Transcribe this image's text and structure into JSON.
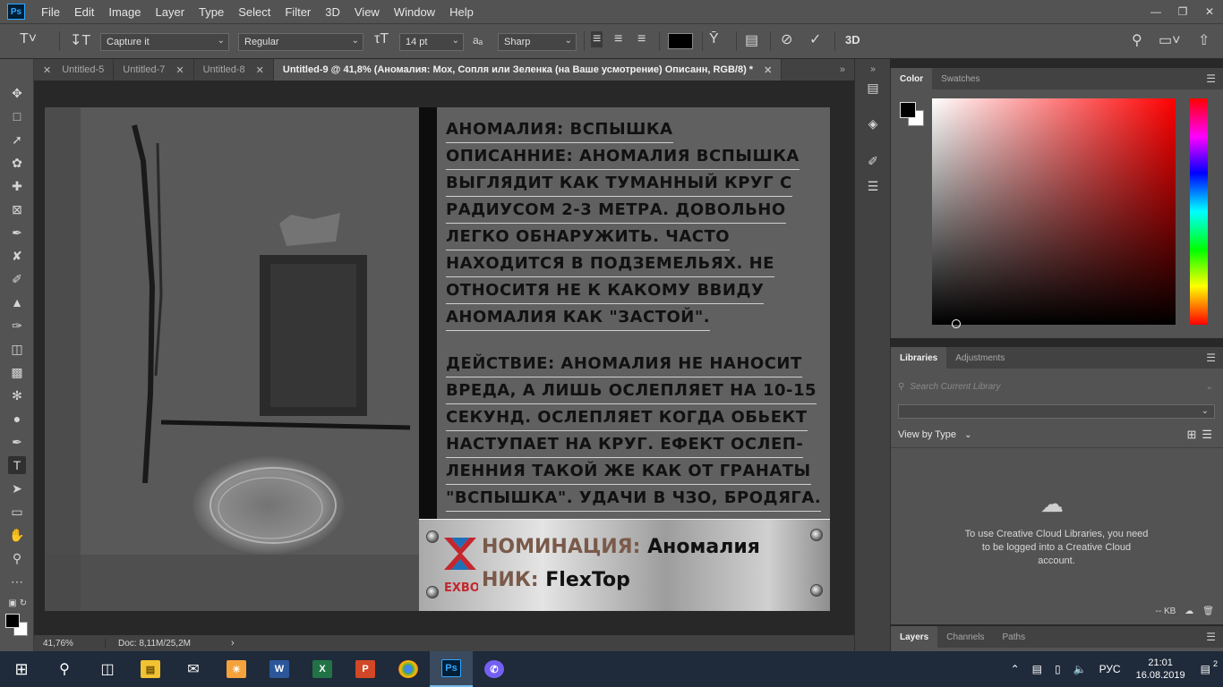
{
  "menubar": {
    "logo": "Ps",
    "items": [
      "File",
      "Edit",
      "Image",
      "Layer",
      "Type",
      "Select",
      "Filter",
      "3D",
      "View",
      "Window",
      "Help"
    ]
  },
  "options": {
    "font_family": "Capture it",
    "font_style": "Regular",
    "font_size": "14 pt",
    "antialias_label": "aₐ",
    "antialias": "Sharp",
    "threeD": "3D"
  },
  "tabs": [
    {
      "label": "Untitled-5"
    },
    {
      "label": "Untitled-7"
    },
    {
      "label": "Untitled-8"
    },
    {
      "label": "Untitled-9 @ 41,8% (Аномалия: Мох, Сопля или Зеленка (на Ваше усмотрение)  Описанн, RGB/8) *"
    }
  ],
  "artwork": {
    "description_lines": [
      "Аномалия: вспышка",
      "Описанние: аномалия вспышка",
      "выглядит как туманный круг с",
      "радиусом 2-3 метра. довольно",
      "легко обнаружить. часто",
      "находится в подземельях. не",
      "относитя не к какому ввиду",
      "аномалия как \"застой\"."
    ],
    "action_lines": [
      "Действие: аномалия не наносит",
      "вреда, а лишь ослепляет на 10-15",
      "секунд. ослепляет когда обьект",
      "наступает на круг. ефект ослеп-",
      "ленния такой же как от гранаты",
      "\"вспышка\". удачи в чзо, бродяга."
    ],
    "plate_label_1": "НОМИНАЦИЯ:",
    "plate_value_1": "Аномалия",
    "plate_label_2": "НИК:",
    "plate_value_2": "FlexTop",
    "logo_text": "EXBO"
  },
  "status": {
    "zoom": "41,76%",
    "doc": "Doc: 8,11M/25,2M"
  },
  "panels": {
    "color_tabs": [
      "Color",
      "Swatches"
    ],
    "library_tabs": [
      "Libraries",
      "Adjustments"
    ],
    "search_placeholder": "Search Current Library",
    "view_by": "View by Type",
    "message": "To use Creative Cloud Libraries, you need to be logged into a Creative Cloud account.",
    "footer_kb": "-- KB",
    "layer_tabs": [
      "Layers",
      "Channels",
      "Paths"
    ]
  },
  "taskbar": {
    "lang": "РУС",
    "time": "21:01",
    "date": "16.08.2019",
    "notifications": "2"
  },
  "colors": {
    "ps_blue": "#31a8ff",
    "ui_panel": "#535353",
    "taskbar": "#1f2a3a"
  }
}
